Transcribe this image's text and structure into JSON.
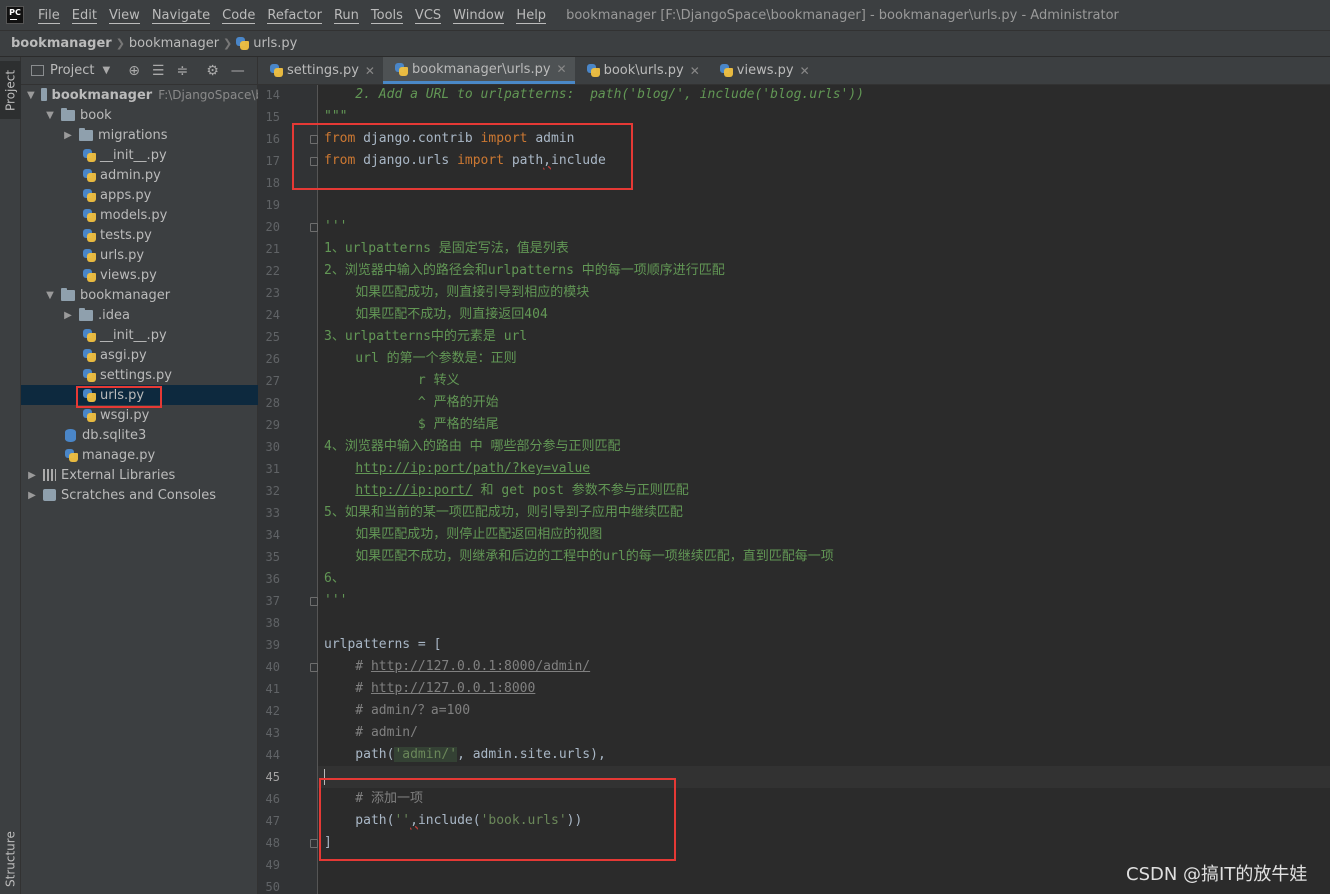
{
  "menubar": {
    "logo": "PC",
    "items": [
      "File",
      "Edit",
      "View",
      "Navigate",
      "Code",
      "Refactor",
      "Run",
      "Tools",
      "VCS",
      "Window",
      "Help"
    ],
    "title": "bookmanager [F:\\DjangoSpace\\bookmanager] - bookmanager\\urls.py - Administrator"
  },
  "breadcrumb": {
    "items": [
      "bookmanager",
      "bookmanager",
      "urls.py"
    ]
  },
  "left_strip": {
    "project_tab": "Project",
    "structure_tab": "Structure"
  },
  "project_panel": {
    "title": "Project",
    "tree": [
      {
        "label": "bookmanager",
        "note": "F:\\DjangoSpace\\b",
        "kind": "root"
      },
      {
        "label": "book",
        "kind": "folder"
      },
      {
        "label": "migrations",
        "kind": "folder"
      },
      {
        "label": "__init__.py",
        "kind": "py"
      },
      {
        "label": "admin.py",
        "kind": "py"
      },
      {
        "label": "apps.py",
        "kind": "py"
      },
      {
        "label": "models.py",
        "kind": "py"
      },
      {
        "label": "tests.py",
        "kind": "py"
      },
      {
        "label": "urls.py",
        "kind": "py"
      },
      {
        "label": "views.py",
        "kind": "py"
      },
      {
        "label": "bookmanager",
        "kind": "folder"
      },
      {
        "label": ".idea",
        "kind": "folder"
      },
      {
        "label": "__init__.py",
        "kind": "py"
      },
      {
        "label": "asgi.py",
        "kind": "py"
      },
      {
        "label": "settings.py",
        "kind": "py"
      },
      {
        "label": "urls.py",
        "kind": "py",
        "selected": true
      },
      {
        "label": "wsgi.py",
        "kind": "py"
      },
      {
        "label": "db.sqlite3",
        "kind": "db"
      },
      {
        "label": "manage.py",
        "kind": "py"
      },
      {
        "label": "External Libraries",
        "kind": "lib"
      },
      {
        "label": "Scratches and Consoles",
        "kind": "scratch"
      }
    ]
  },
  "tabs": [
    {
      "label": "settings.py"
    },
    {
      "label": "bookmanager\\urls.py",
      "active": true
    },
    {
      "label": "book\\urls.py"
    },
    {
      "label": "views.py"
    }
  ],
  "editor": {
    "line_numbers": [
      "14",
      "15",
      "16",
      "17",
      "18",
      "19",
      "20",
      "21",
      "22",
      "23",
      "24",
      "25",
      "26",
      "27",
      "28",
      "29",
      "30",
      "31",
      "32",
      "33",
      "34",
      "35",
      "36",
      "37",
      "38",
      "39",
      "40",
      "41",
      "42",
      "43",
      "44",
      "45",
      "46",
      "47",
      "48",
      "49",
      "50"
    ],
    "current_line": "45",
    "code": {
      "l14": "    2. Add a URL to urlpatterns:  path('blog/', include('blog.urls'))",
      "l15": "\"\"\"",
      "l16_kw1": "from",
      "l16_mid": " django.contrib ",
      "l16_kw2": "import",
      "l16_end": " admin",
      "l17_kw1": "from",
      "l17_mid": " django.urls ",
      "l17_kw2": "import",
      "l17_a": " path",
      "l17_comma": ",",
      "l17_b": "include",
      "l20": "'''",
      "l21": "1、urlpatterns 是固定写法，值是列表",
      "l22": "2、浏览器中输入的路径会和urlpatterns 中的每一项顺序进行匹配",
      "l23": "    如果匹配成功，则直接引导到相应的模块",
      "l24": "    如果匹配不成功，则直接返回404",
      "l25": "3、urlpatterns中的元素是 url",
      "l26": "    url 的第一个参数是：正则",
      "l27": "            r 转义",
      "l28": "            ^ 严格的开始",
      "l29": "            $ 严格的结尾",
      "l30": "4、浏览器中输入的路由 中 哪些部分参与正则匹配",
      "l31_link": "http://ip:port/path/?key=value",
      "l32_link": "http://ip:port/",
      "l32_rest": " 和 get post 参数不参与正则匹配",
      "l33": "5、如果和当前的某一项匹配成功，则引导到子应用中继续匹配",
      "l34": "    如果匹配成功，则停止匹配返回相应的视图",
      "l35": "    如果匹配不成功，则继承和后边的工程中的url的每一项继续匹配，直到匹配每一项",
      "l36": "6、",
      "l37": "'''",
      "l39": "urlpatterns = [",
      "l40_hash": "    # ",
      "l40_link": "http://127.0.0.1:8000/admin/",
      "l41_hash": "    # ",
      "l41_link": "http://127.0.0.1:8000",
      "l42": "    # admin/？a=100",
      "l43": "    # admin/",
      "l44_a": "    path(",
      "l44_str": "'admin/'",
      "l44_b": ", admin.site.urls),",
      "l46": "    # 添加一项",
      "l47_a": "    path(",
      "l47_str1": "''",
      "l47_comma": ",",
      "l47_b": "include(",
      "l47_str2": "'book.urls'",
      "l47_c": "))",
      "l48": "]"
    }
  },
  "watermark": "CSDN @搞IT的放牛娃",
  "colors": {
    "annotation_box": "#e53935",
    "selection": "#0d293e",
    "keyword": "#cc7832",
    "string": "#6a8759"
  }
}
